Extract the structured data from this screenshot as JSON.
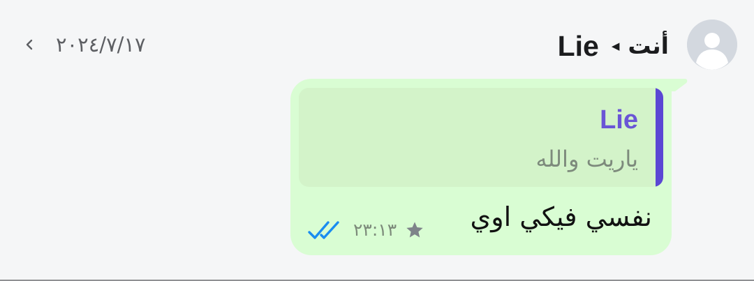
{
  "header": {
    "me_label": "أنت",
    "recipient_name": "Lie",
    "date": "٢٠٢٤/٧/١٧"
  },
  "message": {
    "quoted": {
      "author": "Lie",
      "text": "ياريت والله"
    },
    "text": "نفسي فيكي اوي",
    "time": "٢٣:١٣",
    "starred": true,
    "read_status": "read"
  },
  "colors": {
    "background": "#f5f6f7",
    "bubble": "#d9fdd3",
    "quote_background": "#d3f3c9",
    "quote_bar": "#5b47d4",
    "quote_author": "#6a55d6",
    "read_ticks": "#1a8cf0",
    "star": "#7e8389"
  },
  "icons": {
    "avatar": "default-avatar-icon",
    "header_arrow": "triangle-left-icon",
    "chevron": "chevron-left-icon",
    "star": "star-icon",
    "ticks": "double-check-icon"
  }
}
